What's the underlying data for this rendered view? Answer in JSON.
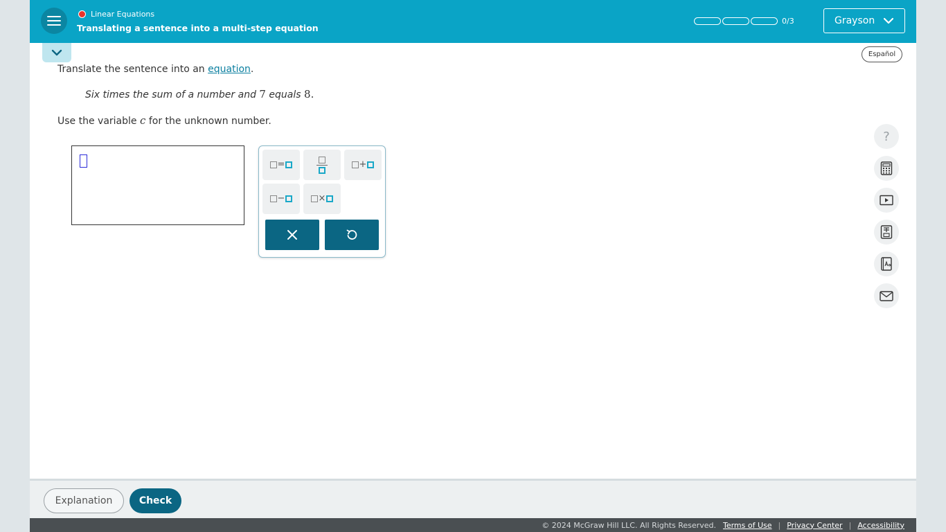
{
  "header": {
    "topic": "Linear Equations",
    "lesson_title": "Translating a sentence into a multi-step equation",
    "progress": {
      "completed": 0,
      "total": 3,
      "label": "0/3"
    },
    "user_name": "Grayson"
  },
  "language_button": "Español",
  "question": {
    "instruction_prefix": "Translate the sentence into an ",
    "instruction_link": "equation",
    "instruction_suffix": ".",
    "sentence_part1": "Six times the sum of a number and ",
    "sentence_num1": "7",
    "sentence_part2": " equals ",
    "sentence_num2": "8",
    "sentence_end": ".",
    "variable_prefix": "Use the variable ",
    "variable": "c",
    "variable_suffix": " for the unknown number."
  },
  "keypad": {
    "keys": [
      "equals-template",
      "fraction-template",
      "plus-template",
      "minus-template",
      "times-template"
    ],
    "equals_op": "=",
    "plus_op": "+",
    "minus_op": "−",
    "times_op": "×"
  },
  "tools": [
    "help-icon",
    "calculator-icon",
    "video-icon",
    "periodic-table-icon",
    "dictionary-icon",
    "mail-icon"
  ],
  "tools_help_glyph": "?",
  "bottom": {
    "explanation_label": "Explanation",
    "check_label": "Check"
  },
  "footer": {
    "copyright": "© 2024 McGraw Hill LLC. All Rights Reserved.",
    "terms": "Terms of Use",
    "privacy": "Privacy Center",
    "accessibility": "Accessibility",
    "separator": "|"
  },
  "colors": {
    "header_bg": "#0aa4c6",
    "primary_button": "#0b6683",
    "topic_dot": "#e8332a",
    "link": "#0b7fa0"
  }
}
